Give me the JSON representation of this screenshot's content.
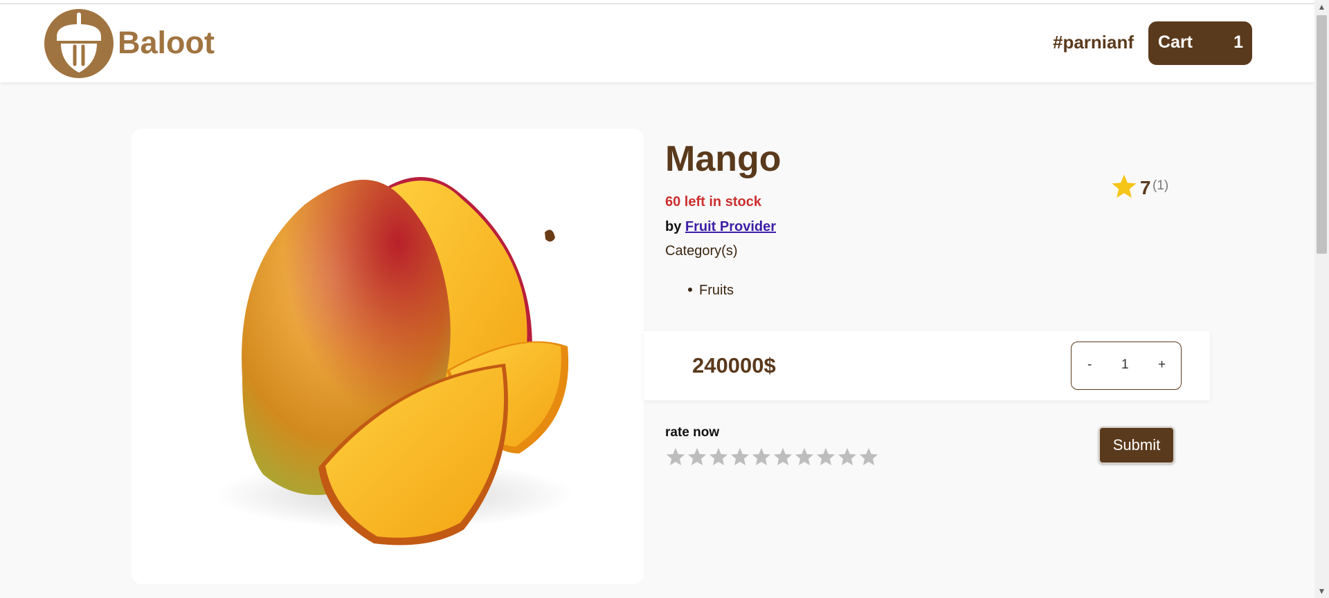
{
  "header": {
    "brand": "Baloot",
    "username": "#parnianf",
    "cart_label": "Cart",
    "cart_count": "1"
  },
  "product": {
    "name": "Mango",
    "rating_value": "7",
    "rating_count": "(1)",
    "stock_text": "60 left in stock",
    "provider_prefix": "by",
    "provider_name": "Fruit Provider",
    "category_label": "Category(s)",
    "categories": [
      "Fruits"
    ],
    "price": "240000$",
    "quantity": "1",
    "minus_label": "-",
    "plus_label": "+"
  },
  "rate": {
    "label": "rate now",
    "star_count": 10,
    "selected": 0,
    "submit_label": "Submit"
  },
  "colors": {
    "brand": "#a07440",
    "dark_brown": "#5a3a1c",
    "stock_red": "#cc2f2f",
    "link": "#3d1ea6",
    "star_filled": "#f5c518",
    "star_empty": "#bdbdbd"
  }
}
